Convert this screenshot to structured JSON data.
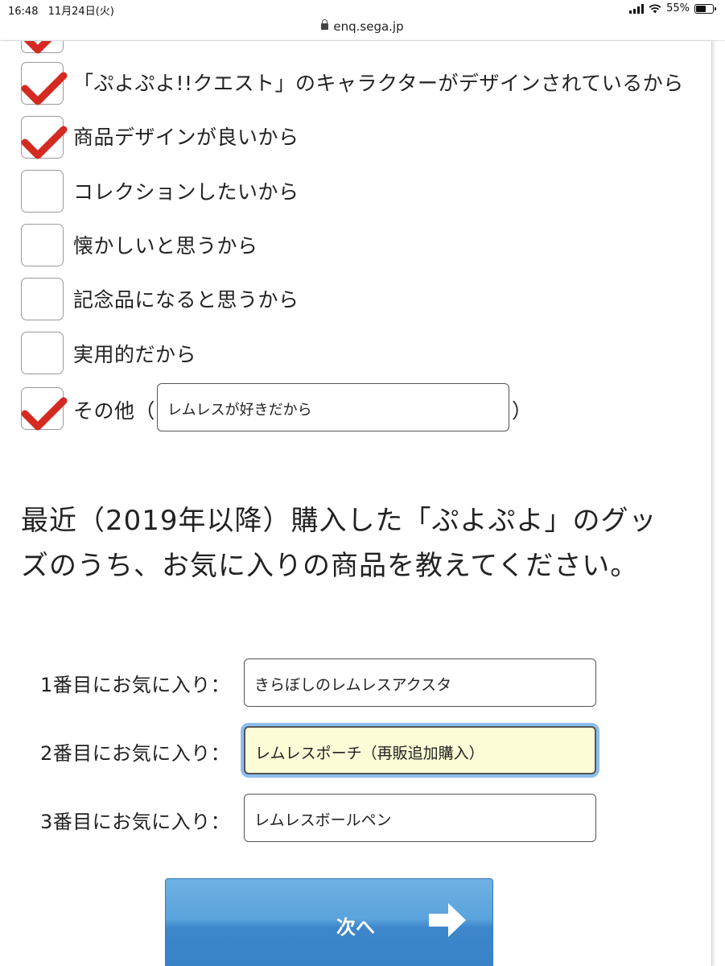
{
  "status_bar": {
    "time": "16:48",
    "date": "11月24日(火)",
    "battery": "55%"
  },
  "browser": {
    "url": "enq.sega.jp"
  },
  "reasons": [
    {
      "label": "「ぷよぷよ!!クエスト」のキャラクターがデザインされているから",
      "checked": true
    },
    {
      "label": "商品デザインが良いから",
      "checked": true
    },
    {
      "label": "コレクションしたいから",
      "checked": false
    },
    {
      "label": "懐かしいと思うから",
      "checked": false
    },
    {
      "label": "記念品になると思うから",
      "checked": false
    },
    {
      "label": "実用的だから",
      "checked": false
    },
    {
      "label": "その他（",
      "checked": true
    }
  ],
  "other": {
    "value": "レムレスが好きだから",
    "close_paren": "）"
  },
  "question": "最近（2019年以降）購入した「ぷよぷよ」のグッズのうち、お気に入りの商品を教えてください。",
  "favorites": [
    {
      "label": "1番目にお気に入り：",
      "value": "きらぼしのレムレスアクスタ"
    },
    {
      "label": "2番目にお気に入り：",
      "value": "レムレスポーチ（再販追加購入）"
    },
    {
      "label": "3番目にお気に入り：",
      "value": "レムレスボールペン"
    }
  ],
  "next_button": {
    "label": "次へ"
  },
  "colors": {
    "check": "#d42a22",
    "button_top": "#6fb1e3",
    "button_bottom": "#3a82c7",
    "focus_ring": "#8cbdf0",
    "focus_fill": "#fcfcd6"
  }
}
